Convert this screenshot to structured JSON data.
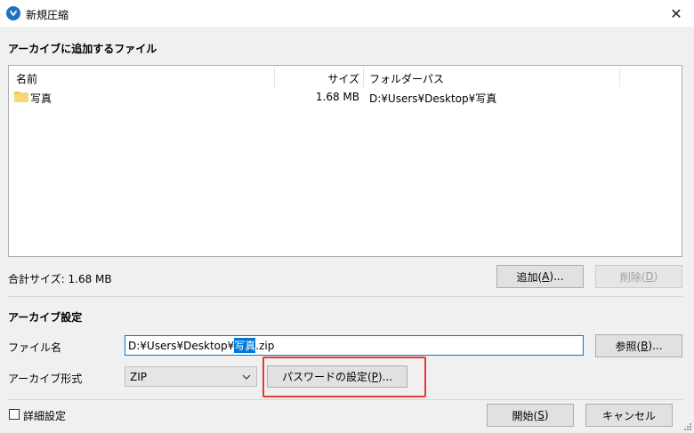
{
  "window": {
    "title": "新規圧縮",
    "close_glyph": "✕"
  },
  "files_section": {
    "heading": "アーカイブに追加するファイル",
    "columns": {
      "name": "名前",
      "size": "サイズ",
      "path": "フォルダーパス"
    },
    "rows": [
      {
        "name": "写真",
        "size": "1.68 MB",
        "path": "D:¥Users¥Desktop¥写真"
      }
    ],
    "total_size": "合計サイズ: 1.68 MB",
    "add_button": {
      "text": "追加(",
      "key": "A",
      "tail": ")..."
    },
    "delete_button": {
      "text": "削除(",
      "key": "D",
      "tail": ")"
    }
  },
  "archive_settings": {
    "heading": "アーカイブ設定",
    "filename_label": "ファイル名",
    "filename_prefix": "D:¥Users¥Desktop¥",
    "filename_selected": "写真",
    "filename_suffix": ".zip",
    "browse_button": {
      "text": "参照(",
      "key": "B",
      "tail": ")..."
    },
    "format_label": "アーカイブ形式",
    "format_value": "ZIP",
    "password_button": {
      "text": "パスワードの設定(",
      "key": "P",
      "tail": ")..."
    }
  },
  "footer": {
    "advanced_label": "詳細設定",
    "start_button": {
      "text": "開始(",
      "key": "S",
      "tail": ")"
    },
    "cancel_label": "キャンセル"
  },
  "colors": {
    "accent": "#0078d7",
    "highlight": "#e53935",
    "folder": "#f3c44a"
  }
}
